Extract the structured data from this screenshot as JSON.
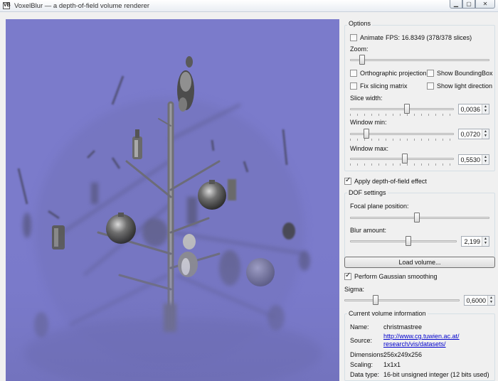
{
  "window": {
    "title": "VoxelBlur — a depth-of-field volume renderer",
    "app_icon": "VB",
    "minimize_icon": "minimize-icon",
    "maximize_icon": "maximize-icon",
    "close_icon": "close-icon"
  },
  "options": {
    "group_title": "Options",
    "animate_label": "Animate",
    "animate_checked": false,
    "fps_text": "FPS: 16.8349 (378/378 slices)",
    "zoom_label": "Zoom:",
    "zoom_level": 0.07,
    "orthographic_label": "Orthographic projection",
    "orthographic_checked": false,
    "show_bbox_label": "Show BoundingBox",
    "show_bbox_checked": false,
    "fix_slicing_label": "Fix slicing matrix",
    "fix_slicing_checked": false,
    "show_light_label": "Show light direction",
    "show_light_checked": false,
    "slice_width_label": "Slice width:",
    "slice_width_value": "0,0036",
    "slice_width_level": 0.55,
    "window_min_label": "Window min:",
    "window_min_value": "0,0720",
    "window_min_level": 0.14,
    "window_max_label": "Window max:",
    "window_max_value": "0,5530",
    "window_max_level": 0.53
  },
  "dof": {
    "apply_label": "Apply depth-of-field effect",
    "apply_checked": true,
    "group_title": "DOF settings",
    "focal_label": "Focal plane position:",
    "focal_level": 0.48,
    "blur_label": "Blur amount:",
    "blur_value": "2,199",
    "blur_level": 0.55
  },
  "load_button": "Load volume...",
  "gaussian": {
    "label": "Perform Gaussian smoothing",
    "checked": true,
    "sigma_label": "Sigma:",
    "sigma_value": "0,6000",
    "sigma_level": 0.26
  },
  "volume_info": {
    "group_title": "Current volume information",
    "name_label": "Name:",
    "name_value": "christmastree",
    "source_label": "Source:",
    "source_line1": "http://www.cg.tuwien.ac.at/",
    "source_line2": "research/vis/datasets/",
    "dimensions_label": "Dimensions:",
    "dimensions_value": "256x249x256",
    "scaling_label": "Scaling:",
    "scaling_value": "1x1x1",
    "datatype_label": "Data type:",
    "datatype_value": "16-bit unsigned integer (12 bits used)"
  },
  "colors": {
    "viewport_background": "#7c7ccc",
    "link": "#0000cc"
  }
}
